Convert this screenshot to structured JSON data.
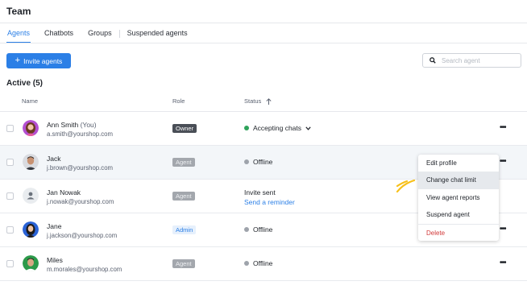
{
  "page": {
    "title": "Team"
  },
  "tabs": [
    {
      "label": "Agents",
      "active": true
    },
    {
      "label": "Chatbots"
    },
    {
      "label": "Groups"
    },
    {
      "label": "Suspended agents"
    }
  ],
  "toolbar": {
    "invite_label": "Invite agents",
    "search_placeholder": "Search agent"
  },
  "section": {
    "title": "Active (5)"
  },
  "columns": {
    "name": "Name",
    "role": "Role",
    "status": "Status"
  },
  "agents": [
    {
      "name": "Ann Smith",
      "you": "(You)",
      "email": "a.smith@yourshop.com",
      "role": "Owner",
      "status": "Accepting chats"
    },
    {
      "name": "Jack",
      "email": "j.brown@yourshop.com",
      "role": "Agent",
      "status": "Offline"
    },
    {
      "name": "Jan Nowak",
      "email": "j.nowak@yourshop.com",
      "role": "Agent",
      "status": "Invite sent",
      "status_link": "Send a reminder"
    },
    {
      "name": "Jane",
      "email": "j.jackson@yourshop.com",
      "role": "Admin",
      "status": "Offline"
    },
    {
      "name": "Miles",
      "email": "m.morales@yourshop.com",
      "role": "Agent",
      "status": "Offline"
    }
  ],
  "context_menu": {
    "items": [
      "Edit profile",
      "Change chat limit",
      "View agent reports",
      "Suspend agent",
      "Delete"
    ]
  },
  "colors": {
    "accent": "#2b7fe6",
    "online": "#2fa35b",
    "danger": "#d23a3a",
    "annotation": "#f7c01a"
  }
}
